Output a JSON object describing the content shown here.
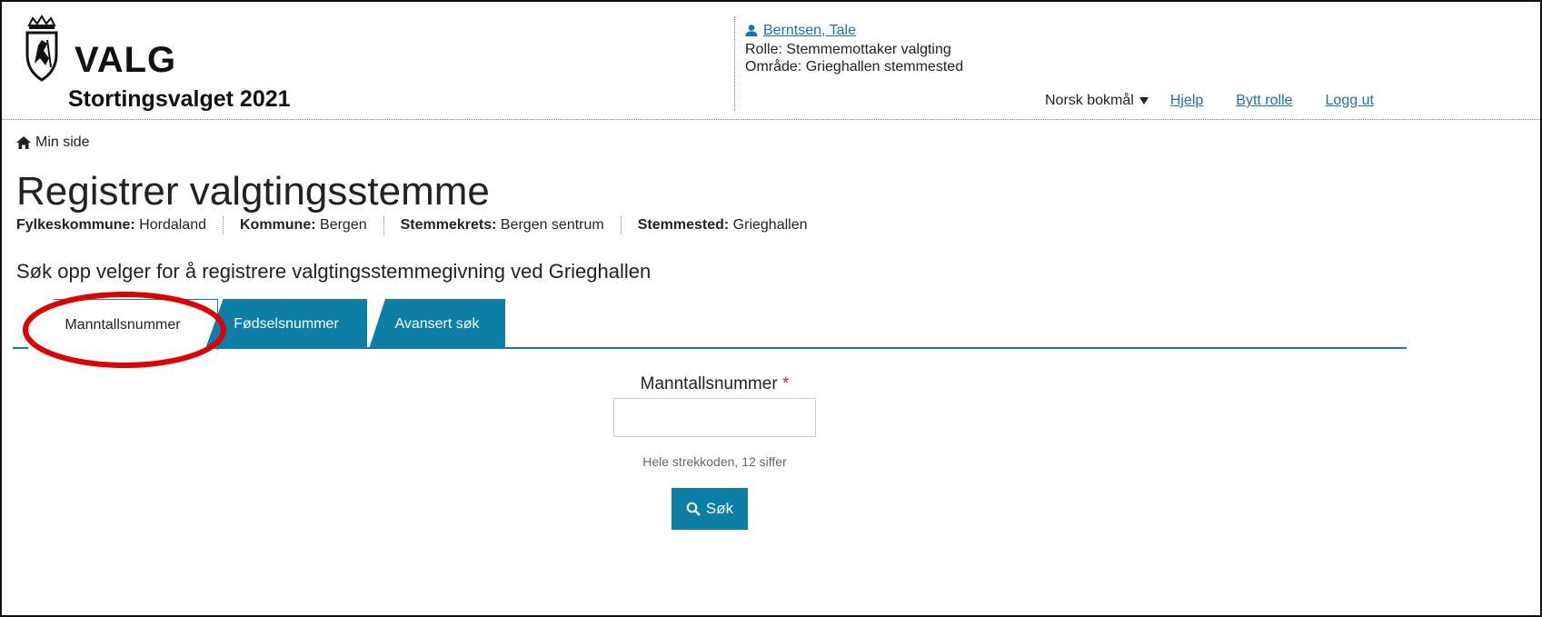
{
  "header": {
    "logo_title": "VALG",
    "logo_subtitle": "Stortingsvalget 2021",
    "user": {
      "name": "Berntsen, Tale",
      "role": "Rolle: Stemmemottaker valgting",
      "area": "Område: Grieghallen stemmested"
    },
    "nav": {
      "language": "Norsk bokmål",
      "help": "Hjelp",
      "switch_role": "Bytt rolle",
      "logout": "Logg ut"
    }
  },
  "breadcrumb": {
    "home": "Min side"
  },
  "page": {
    "title": "Registrer valgtingsstemme",
    "meta": [
      {
        "label": "Fylkeskommune:",
        "value": "Hordaland"
      },
      {
        "label": "Kommune:",
        "value": "Bergen"
      },
      {
        "label": "Stemmekrets:",
        "value": "Bergen sentrum"
      },
      {
        "label": "Stemmested:",
        "value": "Grieghallen"
      }
    ],
    "lead": "Søk opp velger for å registrere valgtingsstemmegivning ved Grieghallen"
  },
  "tabs": [
    {
      "label": "Manntallsnummer",
      "active": true
    },
    {
      "label": "Fødselsnummer",
      "active": false
    },
    {
      "label": "Avansert søk",
      "active": false
    }
  ],
  "form": {
    "field_label": "Manntallsnummer",
    "required_mark": "*",
    "field_value": "",
    "hint": "Hele strekkoden, 12 siffer",
    "search_button": "Søk"
  },
  "colors": {
    "accent": "#0d7ea5",
    "link": "#1a73a8",
    "annotation": "#e00000"
  },
  "icons": [
    "coat-of-arms-icon",
    "user-icon",
    "caret-down-icon",
    "home-icon",
    "search-icon"
  ]
}
